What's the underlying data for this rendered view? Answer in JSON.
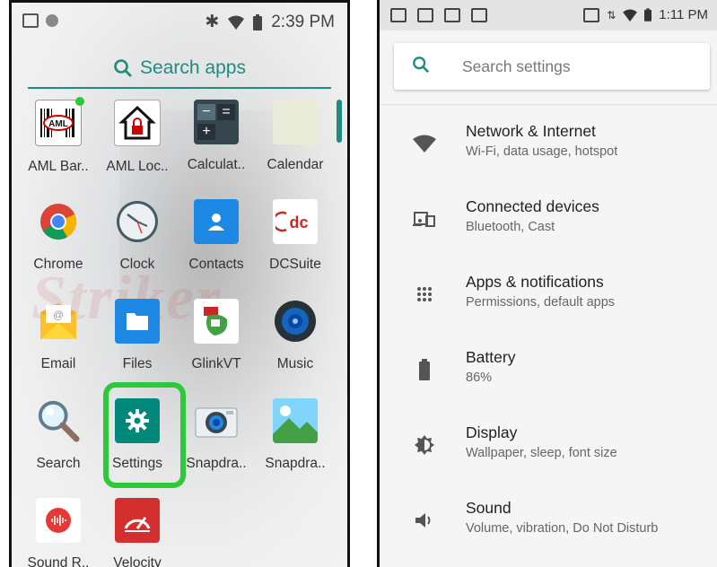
{
  "left_screen": {
    "status_bar": {
      "time": "2:39 PM"
    },
    "search": {
      "label": "Search apps"
    },
    "apps": [
      {
        "label": "AML Bar..",
        "icon": "aml-barcode-icon"
      },
      {
        "label": "AML Loc..",
        "icon": "aml-lock-icon"
      },
      {
        "label": "Calculat..",
        "icon": "calculator-icon"
      },
      {
        "label": "Calendar",
        "icon": "calendar-icon"
      },
      {
        "label": "Chrome",
        "icon": "chrome-icon"
      },
      {
        "label": "Clock",
        "icon": "clock-icon"
      },
      {
        "label": "Contacts",
        "icon": "contacts-icon"
      },
      {
        "label": "DCSuite",
        "icon": "dcsuite-icon"
      },
      {
        "label": "Email",
        "icon": "email-icon"
      },
      {
        "label": "Files",
        "icon": "files-icon"
      },
      {
        "label": "GlinkVT",
        "icon": "glinkvt-icon"
      },
      {
        "label": "Music",
        "icon": "music-icon"
      },
      {
        "label": "Search",
        "icon": "search-icon"
      },
      {
        "label": "Settings",
        "icon": "settings-icon"
      },
      {
        "label": "Snapdra..",
        "icon": "camera-icon"
      },
      {
        "label": "Snapdra..",
        "icon": "gallery-icon"
      },
      {
        "label": "Sound R..",
        "icon": "sound-recorder-icon"
      },
      {
        "label": "Velocity",
        "icon": "velocity-icon"
      }
    ],
    "wallpaper_text": "Striker",
    "highlight_color": "#2ec93a",
    "accent": "#1e8c7e"
  },
  "right_screen": {
    "status_bar": {
      "time": "1:11 PM"
    },
    "search": {
      "placeholder": "Search settings"
    },
    "items": [
      {
        "title": "Network & Internet",
        "subtitle": "Wi-Fi, data usage, hotspot",
        "icon": "wifi-icon"
      },
      {
        "title": "Connected devices",
        "subtitle": "Bluetooth, Cast",
        "icon": "devices-icon"
      },
      {
        "title": "Apps & notifications",
        "subtitle": "Permissions, default apps",
        "icon": "apps-grid-icon"
      },
      {
        "title": "Battery",
        "subtitle": "86%",
        "icon": "battery-icon"
      },
      {
        "title": "Display",
        "subtitle": "Wallpaper, sleep, font size",
        "icon": "brightness-icon"
      },
      {
        "title": "Sound",
        "subtitle": "Volume, vibration, Do Not Disturb",
        "icon": "volume-icon"
      }
    ],
    "accent": "#1e8c7e"
  }
}
